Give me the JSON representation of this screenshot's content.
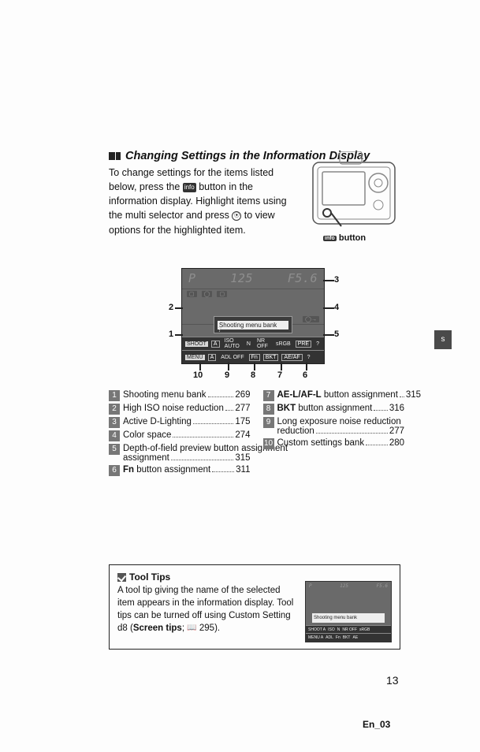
{
  "heading": "Changing Settings in the Information Display",
  "intro_pre": "To change settings for the items listed below, press the ",
  "intro_icon": "info",
  "intro_mid": " button in the information display.  Highlight items using the multi selector and press ",
  "intro_ok": "OK",
  "intro_end": " to view options for the highlighted item.",
  "camera_caption_icon": "info",
  "camera_caption": " button",
  "display": {
    "top_left": "P",
    "top_mid": "125",
    "top_right": "F5.6",
    "tooltip": "Shooting menu bank",
    "row1": [
      "SHOOT",
      "A",
      "ISO AUTO",
      "N",
      "NR OFF",
      "sRGB",
      "PRE",
      "?"
    ],
    "row2": [
      "MENU",
      "A",
      "ADL OFF",
      "Fn",
      "BKT",
      "AE/AF",
      "?"
    ]
  },
  "callouts": {
    "1": "1",
    "2": "2",
    "3": "3",
    "4": "4",
    "5": "5",
    "6": "6",
    "7": "7",
    "8": "8",
    "9": "9",
    "10": "10"
  },
  "legend_left": [
    {
      "n": "1",
      "label": "Shooting menu bank",
      "page": "269"
    },
    {
      "n": "2",
      "label": "High ISO noise reduction",
      "page": "277"
    },
    {
      "n": "3",
      "label": "Active D-Lighting",
      "page": "175"
    },
    {
      "n": "4",
      "label": "Color space",
      "page": "274"
    },
    {
      "n": "5",
      "label": "Depth-of-field preview button assignment",
      "page": "315"
    },
    {
      "n": "6",
      "label_pre": "",
      "label_bold": "Fn",
      "label_post": " button assignment",
      "page": "311"
    }
  ],
  "legend_right": [
    {
      "n": "7",
      "label_pre": "",
      "label_bold": "AE-L/AF-L",
      "label_post": " button assignment",
      "page": "315"
    },
    {
      "n": "8",
      "label_pre": "",
      "label_bold": "BKT",
      "label_post": " button assignment",
      "page": "316"
    },
    {
      "n": "9",
      "label": "Long exposure noise reduction",
      "page": "277"
    },
    {
      "n": "10",
      "label": "Custom settings bank",
      "page": "280"
    }
  ],
  "tooltips": {
    "header": "Tool Tips",
    "body_1": "A tool tip giving the name of the selected item appears in the information display.  Tool tips can be turned off using Custom Setting d8 (",
    "body_bold": "Screen tips",
    "body_2": "; ",
    "body_page": "295",
    "body_3": ").",
    "mini_tooltip": "Shooting menu bank"
  },
  "page_number": "13",
  "footer": "En_03",
  "side_tab": "s"
}
